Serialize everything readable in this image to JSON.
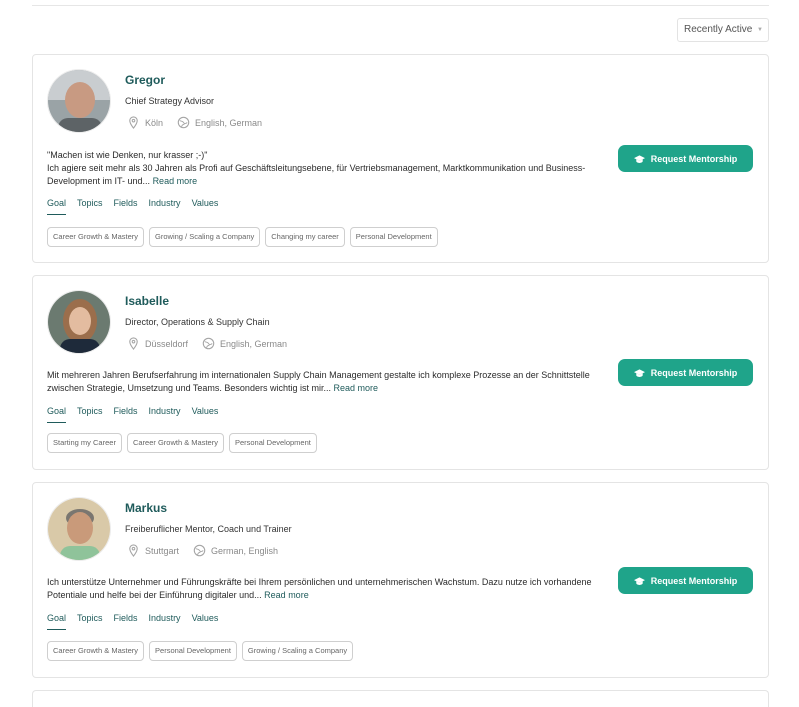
{
  "sort": {
    "label": "Recently Active"
  },
  "tabs": [
    "Goal",
    "Topics",
    "Fields",
    "Industry",
    "Values"
  ],
  "button_label": "Request Mentorship",
  "read_more": "Read more",
  "accent_color": "#1fa48a",
  "mentors": [
    {
      "name": "Gregor",
      "role": "Chief Strategy Advisor",
      "location": "Köln",
      "languages": "English, German",
      "bio_lines": [
        "\"Machen ist wie Denken, nur krasser ;-)\"",
        "Ich agiere seit mehr als 30 Jahren als Profi auf Geschäftsleitungsebene, für Vertriebsmanagement, Marktkommunikation und Business-",
        "Development im IT- und..."
      ],
      "tags": [
        "Career Growth & Mastery",
        "Growing / Scaling a Company",
        "Changing my career",
        "Personal Development"
      ]
    },
    {
      "name": "Isabelle",
      "role": "Director, Operations & Supply Chain",
      "location": "Düsseldorf",
      "languages": "English, German",
      "bio_lines": [
        "Mit mehreren Jahren Berufserfahrung im internationalen Supply Chain Management gestalte ich komplexe Prozesse an der Schnittstelle",
        "zwischen Strategie, Umsetzung und Teams. Besonders wichtig ist mir..."
      ],
      "tags": [
        "Starting my Career",
        "Career Growth & Mastery",
        "Personal Development"
      ]
    },
    {
      "name": "Markus",
      "role": "Freiberuflicher Mentor, Coach und Trainer",
      "location": "Stuttgart",
      "languages": "German, English",
      "bio_lines": [
        "Ich unterstütze Unternehmer und Führungskräfte bei Ihrem persönlichen und unternehmerischen Wachstum. Dazu nutze ich vorhandene",
        "Potentiale und helfe bei der Einführung digitaler und..."
      ],
      "tags": [
        "Career Growth & Mastery",
        "Personal Development",
        "Growing / Scaling a Company"
      ]
    }
  ]
}
